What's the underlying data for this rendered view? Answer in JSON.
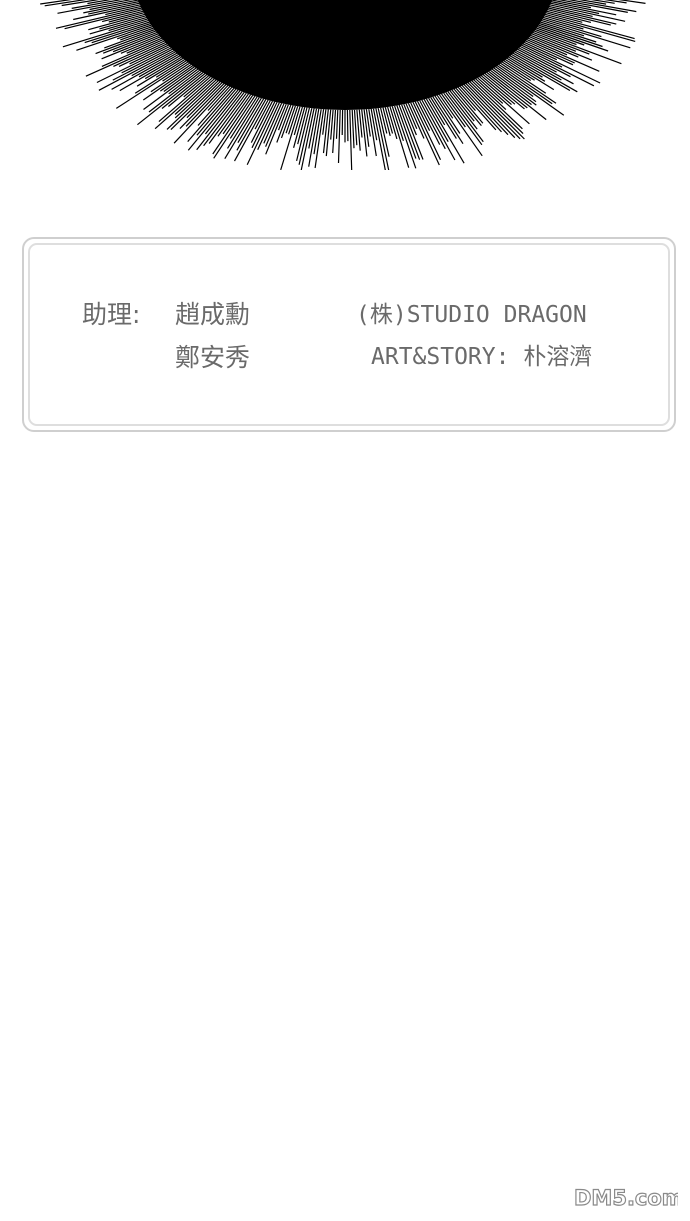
{
  "credits": {
    "assistant_label": "助理:",
    "assistant_name_1": "趙成勳",
    "assistant_name_2": "鄭安秀",
    "studio": "(株)STUDIO DRAGON",
    "art_story": "ART&STORY: 朴溶濟"
  },
  "watermark": {
    "text": "DM5.com"
  },
  "colors": {
    "background": "#ffffff",
    "text": "#6a6a6a",
    "burst": "#000000",
    "box_border": "#cfcfcf"
  }
}
